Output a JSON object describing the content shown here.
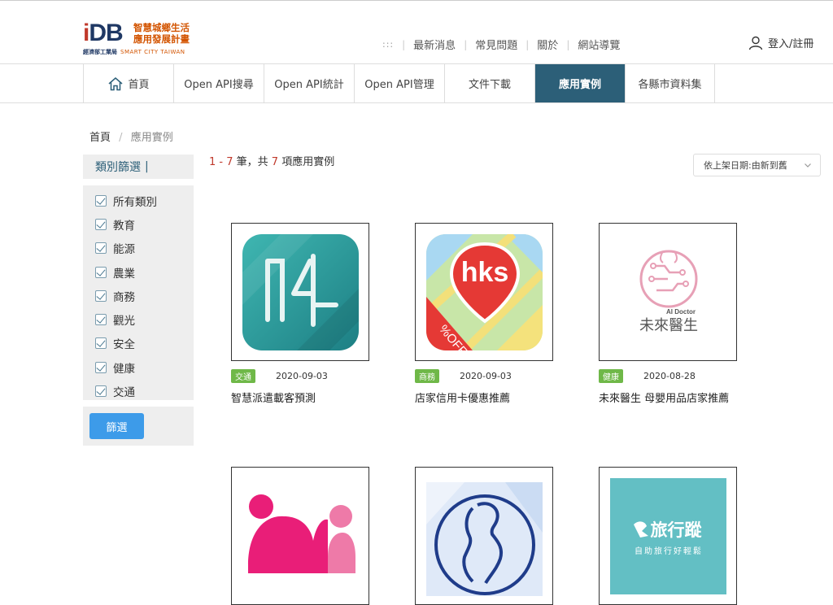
{
  "header": {
    "logo_text": "iDB",
    "logo_cn_line1": "智慧城鄉生活",
    "logo_cn_line2": "應用發展計畫",
    "logo_sub": "經濟部工業局",
    "logo_sub_en": "SMART CITY TAIWAN",
    "top_links": [
      "最新消息",
      "常見問題",
      "關於",
      "網站導覽"
    ],
    "dots": ":::",
    "login_label": "登入/註冊"
  },
  "nav": {
    "items": [
      {
        "label": "首頁",
        "icon": "home-icon",
        "active": false
      },
      {
        "label": "Open API搜尋",
        "active": false
      },
      {
        "label": "Open API統計",
        "active": false
      },
      {
        "label": "Open API管理",
        "active": false
      },
      {
        "label": "文件下載",
        "active": false
      },
      {
        "label": "應用實例",
        "active": true
      },
      {
        "label": "各縣市資料集",
        "active": false
      }
    ]
  },
  "breadcrumb": {
    "home": "首頁",
    "separator": "/",
    "current": "應用實例"
  },
  "sidebar": {
    "heading": "類別篩選",
    "heading_bar": "|",
    "categories": [
      "所有類別",
      "教育",
      "能源",
      "農業",
      "商務",
      "觀光",
      "安全",
      "健康",
      "交通"
    ],
    "button_label": "篩選"
  },
  "results": {
    "range": "1 - 7",
    "label_mid": "筆，共",
    "total": "7",
    "label_end": "項應用實例"
  },
  "sort": {
    "selected": "依上架日期:由新到舊"
  },
  "apps": [
    {
      "category": "交通",
      "date": "2020-09-03",
      "title": "智慧派遣載客預測",
      "icon": "app-icon-04"
    },
    {
      "category": "商務",
      "date": "2020-09-03",
      "title": "店家信用卡優惠推薦",
      "icon": "app-icon-hks",
      "thumb_text": "hks",
      "thumb_subtext": "%OFF"
    },
    {
      "category": "健康",
      "date": "2020-08-28",
      "title": "未來醫生 母嬰用品店家推薦",
      "icon": "app-icon-ai-doctor",
      "thumb_text": "未來醫生",
      "thumb_subtext": "AI Doctor"
    },
    {
      "icon": "app-icon-pink-figures"
    },
    {
      "icon": "app-icon-mother-baby"
    },
    {
      "icon": "app-icon-travel",
      "thumb_text": "旅行蹤",
      "thumb_subtext": "自助旅行好輕鬆"
    }
  ],
  "colors": {
    "nav_active": "#2c5f78",
    "badge_green": "#6fb848",
    "button_blue": "#3d9be9",
    "accent_red": "#c0392b"
  }
}
